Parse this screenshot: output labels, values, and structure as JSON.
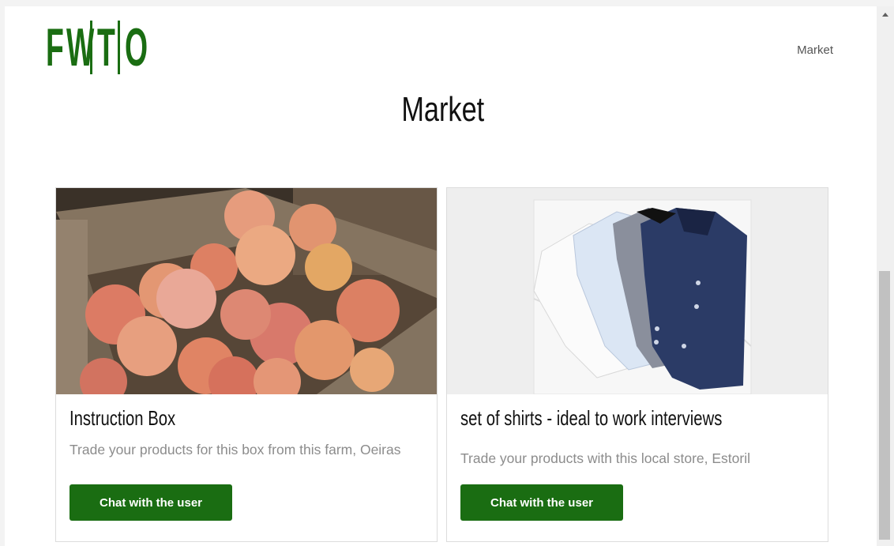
{
  "header": {
    "logo_letters": [
      "F",
      "W",
      "T",
      "O"
    ],
    "nav_market": "Market"
  },
  "main": {
    "title": "Market",
    "cards": [
      {
        "title": "Instruction Box",
        "description": "Trade your products for this box from this farm, Oeiras",
        "button": "Chat with the user",
        "image": "peaches-in-crate"
      },
      {
        "title": "set of shirts - ideal to work interviews",
        "description": "Trade your products with this local store, Estoril",
        "button": "Chat with the user",
        "image": "folded-shirts"
      }
    ]
  },
  "colors": {
    "brand_green": "#1a6d12",
    "text_muted": "#8c8c8c"
  }
}
